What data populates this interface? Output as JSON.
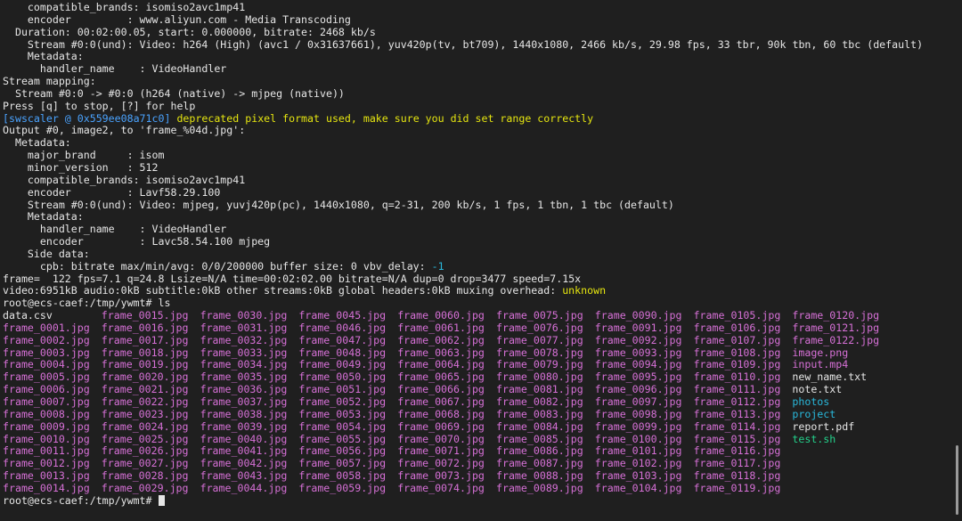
{
  "terminal": {
    "lines_top": [
      {
        "text": "    compatible_brands: isomiso2avc1mp41"
      },
      {
        "text": "    encoder         : www.aliyun.com - Media Transcoding"
      },
      {
        "text": "  Duration: 00:02:00.05, start: 0.000000, bitrate: 2468 kb/s"
      },
      {
        "text": "    Stream #0:0(und): Video: h264 (High) (avc1 / 0x31637661), yuv420p(tv, bt709), 1440x1080, 2466 kb/s, 29.98 fps, 33 tbr, 90k tbn, 60 tbc (default)"
      },
      {
        "text": "    Metadata:"
      },
      {
        "text": "      handler_name    : VideoHandler"
      },
      {
        "text": "Stream mapping:"
      },
      {
        "text": "  Stream #0:0 -> #0:0 (h264 (native) -> mjpeg (native))"
      },
      {
        "text": "Press [q] to stop, [?] for help"
      }
    ],
    "warning": {
      "prefix": "[swscaler @ 0x559ee08a71c0]",
      "message": " deprecated pixel format used, make sure you did set range correctly"
    },
    "lines_mid": [
      {
        "text": "Output #0, image2, to 'frame_%04d.jpg':"
      },
      {
        "text": "  Metadata:"
      },
      {
        "text": "    major_brand     : isom"
      },
      {
        "text": "    minor_version   : 512"
      },
      {
        "text": "    compatible_brands: isomiso2avc1mp41"
      },
      {
        "text": "    encoder         : Lavf58.29.100"
      },
      {
        "text": "    Stream #0:0(und): Video: mjpeg, yuvj420p(pc), 1440x1080, q=2-31, 200 kb/s, 1 fps, 1 tbn, 1 tbc (default)"
      },
      {
        "text": "    Metadata:"
      },
      {
        "text": "      handler_name    : VideoHandler"
      },
      {
        "text": "      encoder         : Lavc58.54.100 mjpeg"
      },
      {
        "text": "    Side data:"
      }
    ],
    "cpb_line": {
      "text": "      cpb: bitrate max/min/avg: 0/0/200000 buffer size: 0 vbv_delay: ",
      "value": "-1"
    },
    "frame_line": {
      "text": "frame=  122 fps=7.1 q=24.8 Lsize=N/A time=00:02:02.00 bitrate=N/A dup=0 drop=3477 speed=7.15x"
    },
    "video_line": {
      "text": "video:6951kB audio:0kB subtitle:0kB other streams:0kB global headers:0kB muxing overhead: ",
      "value": "unknown"
    },
    "prompt_ls": {
      "prompt": "root@ecs-caef:/tmp/ywmt#",
      "command": " ls"
    },
    "ls_rows": [
      [
        {
          "t": "data.csv",
          "c": "white"
        },
        {
          "t": "frame_0015.jpg",
          "c": "magenta"
        },
        {
          "t": "frame_0030.jpg",
          "c": "magenta"
        },
        {
          "t": "frame_0045.jpg",
          "c": "magenta"
        },
        {
          "t": "frame_0060.jpg",
          "c": "magenta"
        },
        {
          "t": "frame_0075.jpg",
          "c": "magenta"
        },
        {
          "t": "frame_0090.jpg",
          "c": "magenta"
        },
        {
          "t": "frame_0105.jpg",
          "c": "magenta"
        },
        {
          "t": "frame_0120.jpg",
          "c": "magenta"
        }
      ],
      [
        {
          "t": "frame_0001.jpg",
          "c": "magenta"
        },
        {
          "t": "frame_0016.jpg",
          "c": "magenta"
        },
        {
          "t": "frame_0031.jpg",
          "c": "magenta"
        },
        {
          "t": "frame_0046.jpg",
          "c": "magenta"
        },
        {
          "t": "frame_0061.jpg",
          "c": "magenta"
        },
        {
          "t": "frame_0076.jpg",
          "c": "magenta"
        },
        {
          "t": "frame_0091.jpg",
          "c": "magenta"
        },
        {
          "t": "frame_0106.jpg",
          "c": "magenta"
        },
        {
          "t": "frame_0121.jpg",
          "c": "magenta"
        }
      ],
      [
        {
          "t": "frame_0002.jpg",
          "c": "magenta"
        },
        {
          "t": "frame_0017.jpg",
          "c": "magenta"
        },
        {
          "t": "frame_0032.jpg",
          "c": "magenta"
        },
        {
          "t": "frame_0047.jpg",
          "c": "magenta"
        },
        {
          "t": "frame_0062.jpg",
          "c": "magenta"
        },
        {
          "t": "frame_0077.jpg",
          "c": "magenta"
        },
        {
          "t": "frame_0092.jpg",
          "c": "magenta"
        },
        {
          "t": "frame_0107.jpg",
          "c": "magenta"
        },
        {
          "t": "frame_0122.jpg",
          "c": "magenta"
        }
      ],
      [
        {
          "t": "frame_0003.jpg",
          "c": "magenta"
        },
        {
          "t": "frame_0018.jpg",
          "c": "magenta"
        },
        {
          "t": "frame_0033.jpg",
          "c": "magenta"
        },
        {
          "t": "frame_0048.jpg",
          "c": "magenta"
        },
        {
          "t": "frame_0063.jpg",
          "c": "magenta"
        },
        {
          "t": "frame_0078.jpg",
          "c": "magenta"
        },
        {
          "t": "frame_0093.jpg",
          "c": "magenta"
        },
        {
          "t": "frame_0108.jpg",
          "c": "magenta"
        },
        {
          "t": "image.png",
          "c": "magenta"
        }
      ],
      [
        {
          "t": "frame_0004.jpg",
          "c": "magenta"
        },
        {
          "t": "frame_0019.jpg",
          "c": "magenta"
        },
        {
          "t": "frame_0034.jpg",
          "c": "magenta"
        },
        {
          "t": "frame_0049.jpg",
          "c": "magenta"
        },
        {
          "t": "frame_0064.jpg",
          "c": "magenta"
        },
        {
          "t": "frame_0079.jpg",
          "c": "magenta"
        },
        {
          "t": "frame_0094.jpg",
          "c": "magenta"
        },
        {
          "t": "frame_0109.jpg",
          "c": "magenta"
        },
        {
          "t": "input.mp4",
          "c": "magenta"
        }
      ],
      [
        {
          "t": "frame_0005.jpg",
          "c": "magenta"
        },
        {
          "t": "frame_0020.jpg",
          "c": "magenta"
        },
        {
          "t": "frame_0035.jpg",
          "c": "magenta"
        },
        {
          "t": "frame_0050.jpg",
          "c": "magenta"
        },
        {
          "t": "frame_0065.jpg",
          "c": "magenta"
        },
        {
          "t": "frame_0080.jpg",
          "c": "magenta"
        },
        {
          "t": "frame_0095.jpg",
          "c": "magenta"
        },
        {
          "t": "frame_0110.jpg",
          "c": "magenta"
        },
        {
          "t": "new_name.txt",
          "c": "white"
        }
      ],
      [
        {
          "t": "frame_0006.jpg",
          "c": "magenta"
        },
        {
          "t": "frame_0021.jpg",
          "c": "magenta"
        },
        {
          "t": "frame_0036.jpg",
          "c": "magenta"
        },
        {
          "t": "frame_0051.jpg",
          "c": "magenta"
        },
        {
          "t": "frame_0066.jpg",
          "c": "magenta"
        },
        {
          "t": "frame_0081.jpg",
          "c": "magenta"
        },
        {
          "t": "frame_0096.jpg",
          "c": "magenta"
        },
        {
          "t": "frame_0111.jpg",
          "c": "magenta"
        },
        {
          "t": "note.txt",
          "c": "white"
        }
      ],
      [
        {
          "t": "frame_0007.jpg",
          "c": "magenta"
        },
        {
          "t": "frame_0022.jpg",
          "c": "magenta"
        },
        {
          "t": "frame_0037.jpg",
          "c": "magenta"
        },
        {
          "t": "frame_0052.jpg",
          "c": "magenta"
        },
        {
          "t": "frame_0067.jpg",
          "c": "magenta"
        },
        {
          "t": "frame_0082.jpg",
          "c": "magenta"
        },
        {
          "t": "frame_0097.jpg",
          "c": "magenta"
        },
        {
          "t": "frame_0112.jpg",
          "c": "magenta"
        },
        {
          "t": "photos",
          "c": "cyan"
        }
      ],
      [
        {
          "t": "frame_0008.jpg",
          "c": "magenta"
        },
        {
          "t": "frame_0023.jpg",
          "c": "magenta"
        },
        {
          "t": "frame_0038.jpg",
          "c": "magenta"
        },
        {
          "t": "frame_0053.jpg",
          "c": "magenta"
        },
        {
          "t": "frame_0068.jpg",
          "c": "magenta"
        },
        {
          "t": "frame_0083.jpg",
          "c": "magenta"
        },
        {
          "t": "frame_0098.jpg",
          "c": "magenta"
        },
        {
          "t": "frame_0113.jpg",
          "c": "magenta"
        },
        {
          "t": "project",
          "c": "cyan"
        }
      ],
      [
        {
          "t": "frame_0009.jpg",
          "c": "magenta"
        },
        {
          "t": "frame_0024.jpg",
          "c": "magenta"
        },
        {
          "t": "frame_0039.jpg",
          "c": "magenta"
        },
        {
          "t": "frame_0054.jpg",
          "c": "magenta"
        },
        {
          "t": "frame_0069.jpg",
          "c": "magenta"
        },
        {
          "t": "frame_0084.jpg",
          "c": "magenta"
        },
        {
          "t": "frame_0099.jpg",
          "c": "magenta"
        },
        {
          "t": "frame_0114.jpg",
          "c": "magenta"
        },
        {
          "t": "report.pdf",
          "c": "white"
        }
      ],
      [
        {
          "t": "frame_0010.jpg",
          "c": "magenta"
        },
        {
          "t": "frame_0025.jpg",
          "c": "magenta"
        },
        {
          "t": "frame_0040.jpg",
          "c": "magenta"
        },
        {
          "t": "frame_0055.jpg",
          "c": "magenta"
        },
        {
          "t": "frame_0070.jpg",
          "c": "magenta"
        },
        {
          "t": "frame_0085.jpg",
          "c": "magenta"
        },
        {
          "t": "frame_0100.jpg",
          "c": "magenta"
        },
        {
          "t": "frame_0115.jpg",
          "c": "magenta"
        },
        {
          "t": "test.sh",
          "c": "green"
        }
      ],
      [
        {
          "t": "frame_0011.jpg",
          "c": "magenta"
        },
        {
          "t": "frame_0026.jpg",
          "c": "magenta"
        },
        {
          "t": "frame_0041.jpg",
          "c": "magenta"
        },
        {
          "t": "frame_0056.jpg",
          "c": "magenta"
        },
        {
          "t": "frame_0071.jpg",
          "c": "magenta"
        },
        {
          "t": "frame_0086.jpg",
          "c": "magenta"
        },
        {
          "t": "frame_0101.jpg",
          "c": "magenta"
        },
        {
          "t": "frame_0116.jpg",
          "c": "magenta"
        },
        {
          "t": "",
          "c": "white"
        }
      ],
      [
        {
          "t": "frame_0012.jpg",
          "c": "magenta"
        },
        {
          "t": "frame_0027.jpg",
          "c": "magenta"
        },
        {
          "t": "frame_0042.jpg",
          "c": "magenta"
        },
        {
          "t": "frame_0057.jpg",
          "c": "magenta"
        },
        {
          "t": "frame_0072.jpg",
          "c": "magenta"
        },
        {
          "t": "frame_0087.jpg",
          "c": "magenta"
        },
        {
          "t": "frame_0102.jpg",
          "c": "magenta"
        },
        {
          "t": "frame_0117.jpg",
          "c": "magenta"
        },
        {
          "t": "",
          "c": "white"
        }
      ],
      [
        {
          "t": "frame_0013.jpg",
          "c": "magenta"
        },
        {
          "t": "frame_0028.jpg",
          "c": "magenta"
        },
        {
          "t": "frame_0043.jpg",
          "c": "magenta"
        },
        {
          "t": "frame_0058.jpg",
          "c": "magenta"
        },
        {
          "t": "frame_0073.jpg",
          "c": "magenta"
        },
        {
          "t": "frame_0088.jpg",
          "c": "magenta"
        },
        {
          "t": "frame_0103.jpg",
          "c": "magenta"
        },
        {
          "t": "frame_0118.jpg",
          "c": "magenta"
        },
        {
          "t": "",
          "c": "white"
        }
      ],
      [
        {
          "t": "frame_0014.jpg",
          "c": "magenta"
        },
        {
          "t": "frame_0029.jpg",
          "c": "magenta"
        },
        {
          "t": "frame_0044.jpg",
          "c": "magenta"
        },
        {
          "t": "frame_0059.jpg",
          "c": "magenta"
        },
        {
          "t": "frame_0074.jpg",
          "c": "magenta"
        },
        {
          "t": "frame_0089.jpg",
          "c": "magenta"
        },
        {
          "t": "frame_0104.jpg",
          "c": "magenta"
        },
        {
          "t": "frame_0119.jpg",
          "c": "magenta"
        },
        {
          "t": "",
          "c": "white"
        }
      ]
    ],
    "prompt_final": {
      "prompt": "root@ecs-caef:/tmp/ywmt#",
      "command": " "
    }
  },
  "colors": {
    "background": "#1f1f1f",
    "foreground": "#e6e6e6",
    "yellow": "#e5e510",
    "cyan": "#29b8db",
    "magenta": "#d670d6",
    "green": "#23d18b"
  }
}
